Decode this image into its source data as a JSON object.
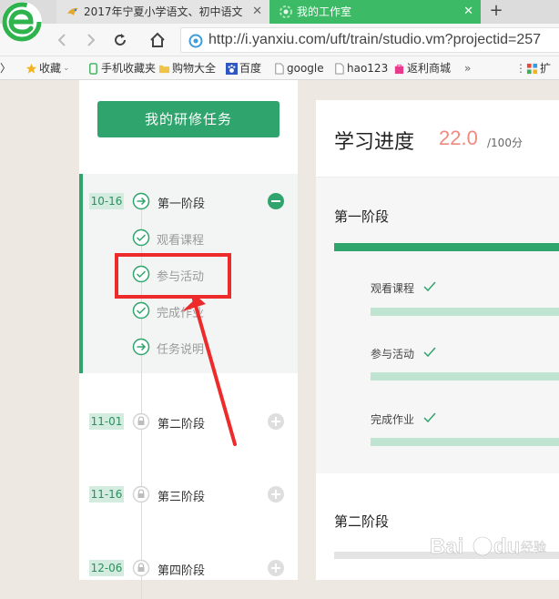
{
  "browser": {
    "tabs": [
      {
        "title": "2017年宁夏小学语文、初中语文",
        "active": false
      },
      {
        "title": "我的工作室",
        "active": true
      }
    ],
    "new_tab": "+",
    "url": "http://i.yanxiu.com/uft/train/studio.vm?projectid=257"
  },
  "bookmarks": [
    {
      "label": "收藏",
      "icon": "star-icon"
    },
    {
      "label": "手机收藏夹",
      "icon": "phone-icon"
    },
    {
      "label": "购物大全",
      "icon": "folder-icon"
    },
    {
      "label": "百度",
      "icon": "baidu-paw-icon"
    },
    {
      "label": "google",
      "icon": "page-icon"
    },
    {
      "label": "hao123",
      "icon": "page-icon"
    },
    {
      "label": "返利商城",
      "icon": "bag-icon"
    },
    {
      "label": "»",
      "icon": ""
    },
    {
      "label": "扩",
      "icon": "grid-icon"
    }
  ],
  "sidebar": {
    "button_label": "我的研修任务",
    "stages": [
      {
        "date": "10-16",
        "title": "第一阶段",
        "expanded": true,
        "items": [
          {
            "label": "观看课程",
            "status": "done"
          },
          {
            "label": "参与活动",
            "status": "done"
          },
          {
            "label": "完成作业",
            "status": "done"
          },
          {
            "label": "任务说明",
            "status": "arrow"
          }
        ]
      },
      {
        "date": "11-01",
        "title": "第二阶段",
        "locked": true
      },
      {
        "date": "11-16",
        "title": "第三阶段",
        "locked": true
      },
      {
        "date": "12-06",
        "title": "第四阶段",
        "locked": true
      }
    ]
  },
  "main": {
    "progress_label": "学习进度",
    "progress_value": "22.0",
    "progress_max": "/100分",
    "stage1": {
      "title": "第一阶段",
      "tasks": [
        {
          "label": "观看课程"
        },
        {
          "label": "参与活动"
        },
        {
          "label": "完成作业"
        }
      ]
    },
    "stage2": {
      "title": "第二阶段"
    }
  },
  "watermark": "Bai du 经验",
  "colors": {
    "brand_green": "#2fa56d",
    "annotation_red": "#ee2b2b",
    "score": "#f08a80"
  }
}
